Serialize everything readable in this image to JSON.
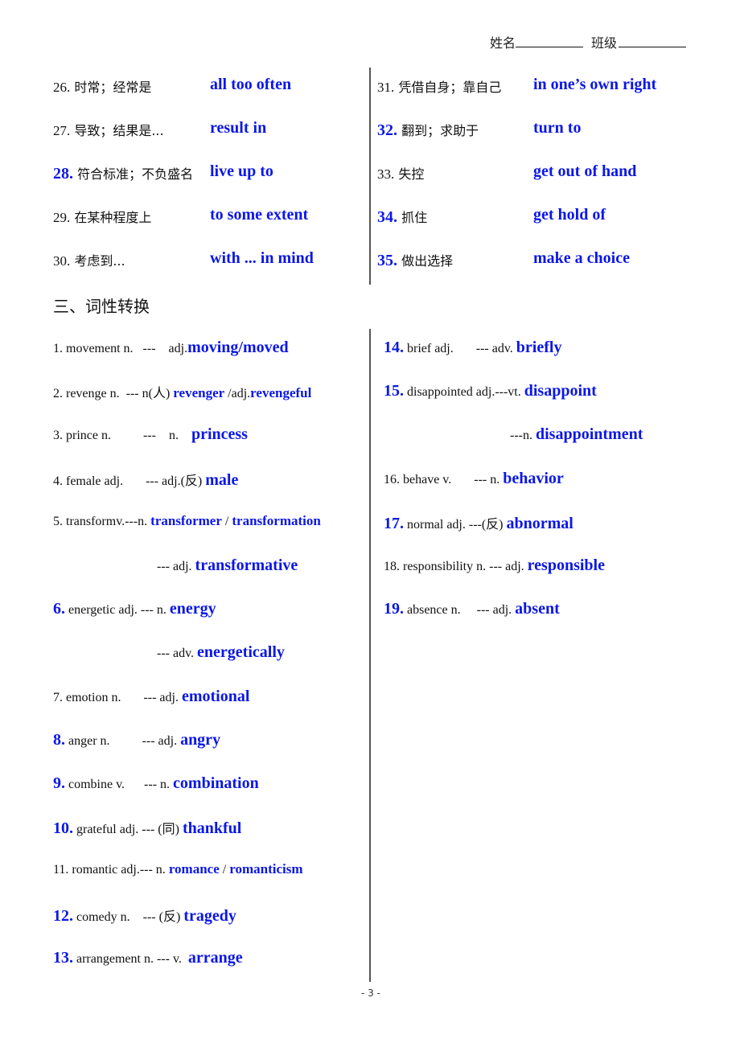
{
  "header": {
    "name_label": "姓名",
    "class_label": "班级"
  },
  "phrases_left": [
    {
      "num": "26.",
      "highlight": false,
      "zh": "时常；经常是",
      "en": "all too often"
    },
    {
      "num": "27.",
      "highlight": false,
      "zh": "导致；结果是...",
      "en": "result in"
    },
    {
      "num": "28.",
      "highlight": true,
      "zh": "符合标准；不负盛名",
      "en": "live up to"
    },
    {
      "num": "29.",
      "highlight": false,
      "zh": "在某种程度上",
      "en": "to some extent"
    },
    {
      "num": "30.",
      "highlight": false,
      "zh": "考虑到...",
      "en": "with ... in mind"
    }
  ],
  "phrases_right": [
    {
      "num": "31.",
      "highlight": false,
      "zh": "凭借自身；靠自己",
      "en": "in one’s own right"
    },
    {
      "num": "32.",
      "highlight": true,
      "zh": "翻到；求助于",
      "en": "turn to"
    },
    {
      "num": "33.",
      "highlight": false,
      "zh": "失控",
      "en": "get out of hand"
    },
    {
      "num": "34.",
      "highlight": true,
      "zh": "抓住",
      "en": "get hold of"
    },
    {
      "num": "35.",
      "highlight": true,
      "zh": "做出选择",
      "en": "make a choice"
    }
  ],
  "section_title": "三、词性转换",
  "conversions_left": [
    {
      "num": "1.",
      "highlight": false,
      "base": "movement n.   ---    adj.",
      "answer": "moving/moved"
    },
    {
      "num": "2.",
      "highlight": false,
      "base": "revenge n.  --- n(人) ",
      "answer": "revenger",
      "mid": " /adj.",
      "answer2": "revengeful",
      "small": true
    },
    {
      "num": "3.",
      "highlight": false,
      "base": "prince n.          ---    n.    ",
      "answer": "princess"
    },
    {
      "num": "4.",
      "highlight": false,
      "base": "female adj.       --- adj.(反) ",
      "answer": "male"
    },
    {
      "num": "5.",
      "highlight": false,
      "base": "transformv.---n. ",
      "answer": "transformer",
      "mid": " / ",
      "answer2": "transformation",
      "small": true
    },
    {
      "num": "",
      "highlight": false,
      "base": "--- adj. ",
      "answer": "transformative",
      "indent": true
    },
    {
      "num": "6.",
      "highlight": true,
      "base": "energetic adj. --- n. ",
      "answer": "energy"
    },
    {
      "num": "",
      "highlight": false,
      "base": "--- adv. ",
      "answer": "energetically",
      "indent": true
    },
    {
      "num": "7.",
      "highlight": false,
      "base": "emotion n.       --- adj. ",
      "answer": "emotional"
    },
    {
      "num": "8.",
      "highlight": true,
      "base": "anger n.          --- adj. ",
      "answer": "angry"
    },
    {
      "num": "9.",
      "highlight": true,
      "base": "combine v.      --- n. ",
      "answer": "combination"
    },
    {
      "num": "10.",
      "highlight": true,
      "base": "grateful adj. --- (同) ",
      "answer": "thankful"
    },
    {
      "num": "11.",
      "highlight": false,
      "base": "romantic adj.--- n. ",
      "answer": "romance",
      "mid": " / ",
      "answer2": "romanticism",
      "small": true
    },
    {
      "num": "12.",
      "highlight": true,
      "base": "comedy n.    --- (反) ",
      "answer": "tragedy"
    },
    {
      "num": "13.",
      "highlight": true,
      "base": "arrangement n. --- v.  ",
      "answer": "arrange"
    }
  ],
  "conversions_right": [
    {
      "num": "14.",
      "highlight": true,
      "base": "brief adj.       --- adv. ",
      "answer": "briefly"
    },
    {
      "num": "15.",
      "highlight": true,
      "base": "disappointed adj.---vt. ",
      "answer": "disappoint"
    },
    {
      "num": "",
      "highlight": false,
      "base": "---n. ",
      "answer": "disappointment",
      "indent": true
    },
    {
      "num": "16.",
      "highlight": false,
      "base": "behave v.       --- n. ",
      "answer": "behavior"
    },
    {
      "num": "17.",
      "highlight": true,
      "base": "normal adj. ---(反) ",
      "answer": "abnormal"
    },
    {
      "num": "18.",
      "highlight": false,
      "base": "responsibility n. --- adj. ",
      "answer": "responsible"
    },
    {
      "num": "19.",
      "highlight": true,
      "base": "absence n.     --- adj. ",
      "answer": "absent"
    }
  ],
  "page_number": "- 3 -"
}
